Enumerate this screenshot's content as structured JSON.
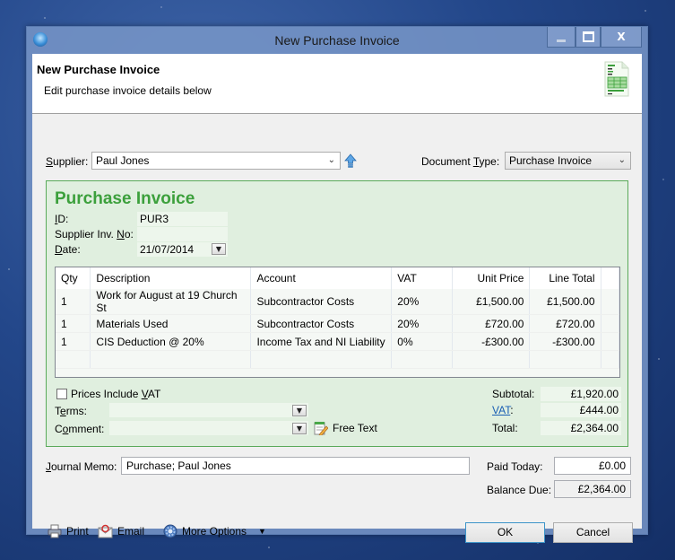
{
  "window": {
    "title": "New Purchase Invoice"
  },
  "header": {
    "title": "New Purchase Invoice",
    "subtitle": "Edit purchase invoice details below"
  },
  "supplier": {
    "label": "Supplier:",
    "value": "Paul Jones"
  },
  "document_type": {
    "label_pre": "Document ",
    "label_u": "T",
    "label_post": "ype:",
    "value": "Purchase Invoice"
  },
  "invoice": {
    "title": "Purchase Invoice",
    "id_label_u": "I",
    "id_label_post": "D:",
    "id_value": "PUR3",
    "supplier_inv_label_pre": "Supplier Inv. ",
    "supplier_inv_label_u": "N",
    "supplier_inv_label_post": "o:",
    "supplier_inv_value": "",
    "date_label_u": "D",
    "date_label_post": "ate:",
    "date_value": "21/07/2014"
  },
  "lines": {
    "columns": [
      "Qty",
      "Description",
      "Account",
      "VAT",
      "Unit Price",
      "Line Total"
    ],
    "rows": [
      {
        "qty": "1",
        "description": "Work for August at 19 Church St",
        "account": "Subcontractor Costs",
        "vat": "20%",
        "unit_price": "£1,500.00",
        "line_total": "£1,500.00"
      },
      {
        "qty": "1",
        "description": "Materials Used",
        "account": "Subcontractor Costs",
        "vat": "20%",
        "unit_price": "£720.00",
        "line_total": "£720.00"
      },
      {
        "qty": "1",
        "description": "CIS Deduction @ 20%",
        "account": "Income Tax and NI Liability",
        "vat": "0%",
        "unit_price": "-£300.00",
        "line_total": "-£300.00"
      }
    ]
  },
  "options": {
    "prices_include_vat_pre": "Prices Include ",
    "prices_include_vat_u": "V",
    "prices_include_vat_post": "AT",
    "prices_include_vat_checked": false,
    "terms_label_pre": "T",
    "terms_label_u": "e",
    "terms_label_post": "rms:",
    "terms_value": "",
    "comment_label_pre": "C",
    "comment_label_u": "o",
    "comment_label_post": "mment:",
    "comment_value": "",
    "free_text_label": "Free Text"
  },
  "totals": {
    "subtotal_label": "Subtotal:",
    "subtotal_value": "£1,920.00",
    "vat_label": "VAT",
    "vat_value": "£444.00",
    "total_label": "Total:",
    "total_value": "£2,364.00"
  },
  "journal_memo": {
    "label_u": "J",
    "label_post": "ournal Memo:",
    "value": "Purchase; Paul Jones"
  },
  "payment": {
    "paid_today_label": "Paid Today:",
    "paid_today_value": "£0.00",
    "balance_due_label": "Balance Due:",
    "balance_due_value": "£2,364.00"
  },
  "toolbar": {
    "print_label": "Print",
    "email_label": "Email",
    "more_options_label": "More Options"
  },
  "buttons": {
    "ok_label": "OK",
    "cancel_label": "Cancel"
  }
}
